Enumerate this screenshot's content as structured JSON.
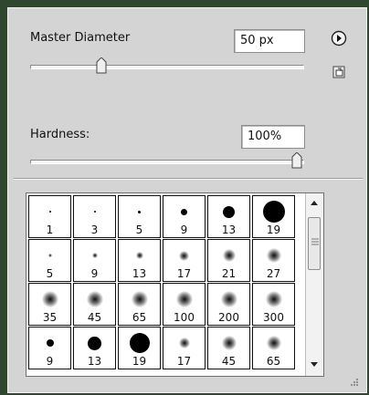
{
  "brush_panel": {
    "master_diameter": {
      "label": "Master Diameter",
      "value": "50 px",
      "slider_fraction": 0.25
    },
    "hardness": {
      "label": "Hardness:",
      "value": "100%",
      "slider_fraction": 1.0
    }
  },
  "brush_presets": [
    {
      "label": "1",
      "size": 2,
      "soft": false
    },
    {
      "label": "3",
      "size": 2,
      "soft": false
    },
    {
      "label": "5",
      "size": 3,
      "soft": false
    },
    {
      "label": "9",
      "size": 7,
      "soft": false
    },
    {
      "label": "13",
      "size": 13,
      "soft": false
    },
    {
      "label": "19",
      "size": 24,
      "soft": false
    },
    {
      "label": "5",
      "size": 4,
      "soft": true
    },
    {
      "label": "9",
      "size": 6,
      "soft": true
    },
    {
      "label": "13",
      "size": 8,
      "soft": true
    },
    {
      "label": "17",
      "size": 11,
      "soft": true
    },
    {
      "label": "21",
      "size": 14,
      "soft": true
    },
    {
      "label": "27",
      "size": 16,
      "soft": true
    },
    {
      "label": "35",
      "size": 18,
      "soft": true
    },
    {
      "label": "45",
      "size": 18,
      "soft": true
    },
    {
      "label": "65",
      "size": 18,
      "soft": true
    },
    {
      "label": "100",
      "size": 18,
      "soft": true
    },
    {
      "label": "200",
      "size": 18,
      "soft": true
    },
    {
      "label": "300",
      "size": 18,
      "soft": true
    },
    {
      "label": "9",
      "size": 8,
      "soft": false
    },
    {
      "label": "13",
      "size": 15,
      "soft": false
    },
    {
      "label": "19",
      "size": 22,
      "soft": false
    },
    {
      "label": "17",
      "size": 12,
      "soft": true
    },
    {
      "label": "45",
      "size": 16,
      "soft": true
    },
    {
      "label": "65",
      "size": 16,
      "soft": true
    }
  ],
  "icons": {
    "flyout": "flyout-menu-arrow-icon",
    "new_preset": "new-preset-icon",
    "scroll_up": "scroll-up-arrow-icon",
    "scroll_down": "scroll-down-arrow-icon",
    "grip": "resize-grip-icon"
  }
}
